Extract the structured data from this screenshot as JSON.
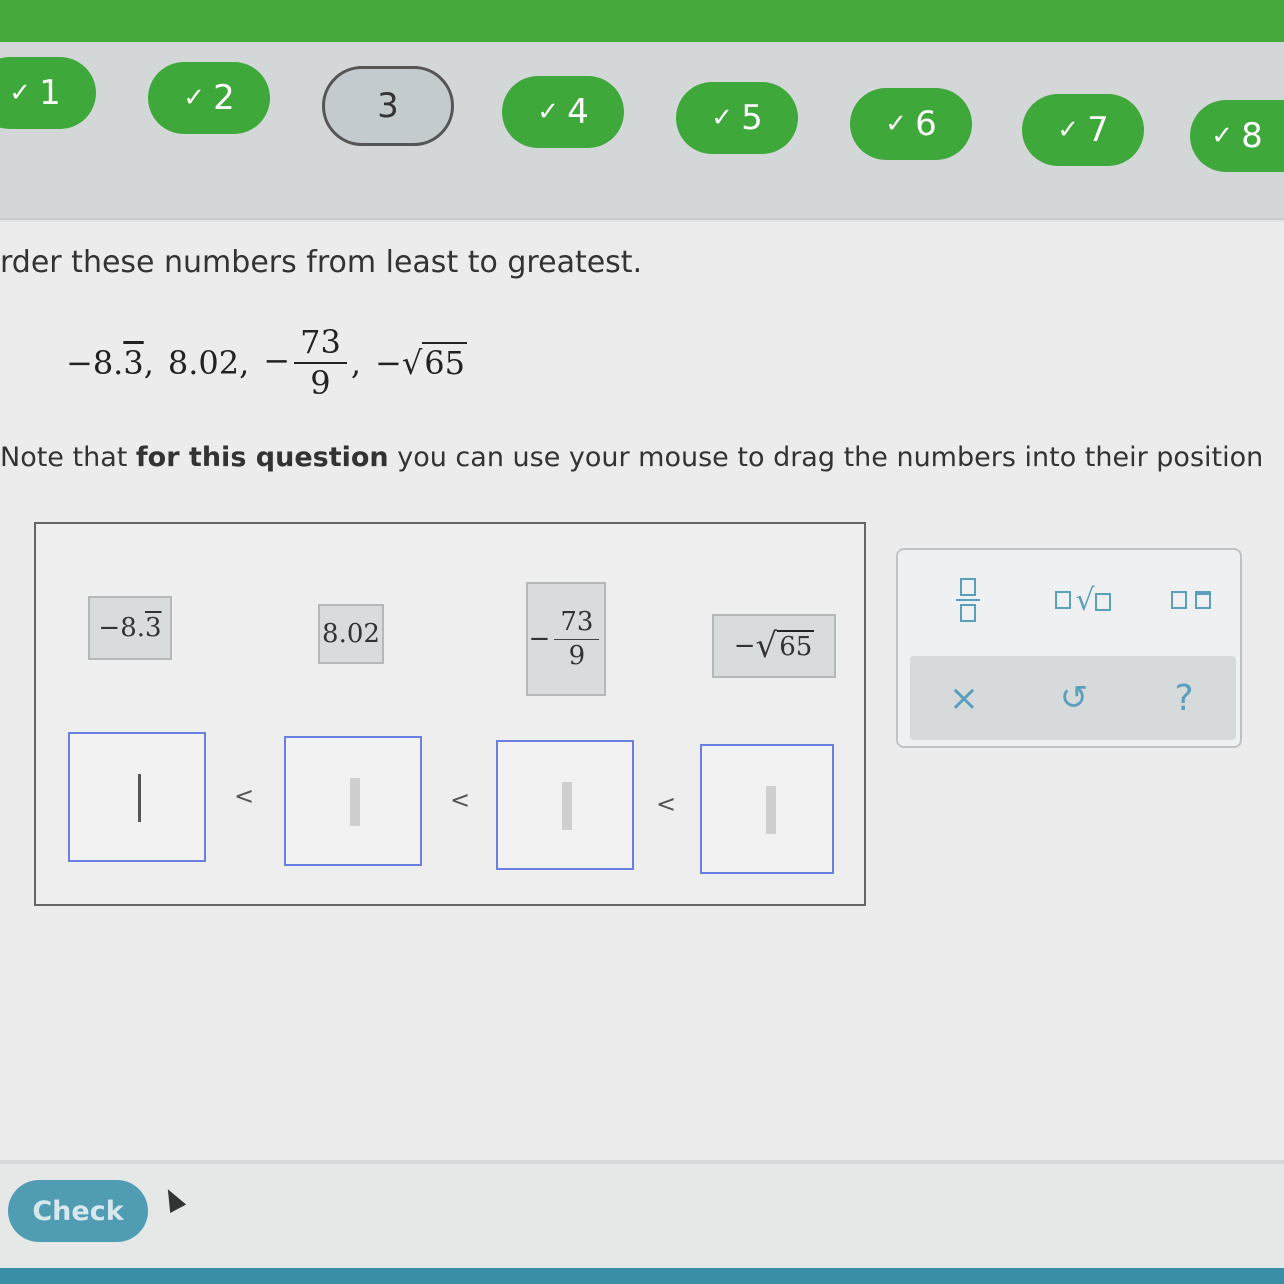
{
  "nav": {
    "items": [
      {
        "label": "1",
        "status": "complete"
      },
      {
        "label": "2",
        "status": "complete"
      },
      {
        "label": "3",
        "status": "current"
      },
      {
        "label": "4",
        "status": "complete"
      },
      {
        "label": "5",
        "status": "complete"
      },
      {
        "label": "6",
        "status": "complete"
      },
      {
        "label": "7",
        "status": "complete"
      },
      {
        "label": "8",
        "status": "complete"
      }
    ],
    "check_glyph": "✓"
  },
  "question": {
    "prompt": "rder these numbers from least to greatest.",
    "numbers": {
      "n1_sign": "−",
      "n1_int": "8.",
      "n1_rep": "3",
      "n2": "8.02",
      "n3_sign": "−",
      "n3_num": "73",
      "n3_den": "9",
      "n4_sign": "−",
      "n4_root": "√",
      "n4_rad": "65",
      "sep": ","
    },
    "note_pre": "Note that ",
    "note_bold": "for this question",
    "note_post": " you can use your mouse to drag the numbers into their position"
  },
  "tiles": {
    "t1_sign": "−",
    "t1_int": "8.",
    "t1_rep": "3",
    "t2": "8.02",
    "t3_sign": "−",
    "t3_num": "73",
    "t3_den": "9",
    "t4_sign": "−",
    "t4_root": "√",
    "t4_rad": "65"
  },
  "answer": {
    "separator": "<"
  },
  "palette": {
    "clear_glyph": "×",
    "undo_glyph": "↺",
    "help_glyph": "?",
    "root_glyph": "√"
  },
  "footer": {
    "check_label": "Check"
  },
  "colors": {
    "accent_green": "#3ea83a",
    "check_button": "#4f9cb3",
    "slot_border": "#6b7fe0",
    "palette_icon": "#5aa0bc"
  }
}
